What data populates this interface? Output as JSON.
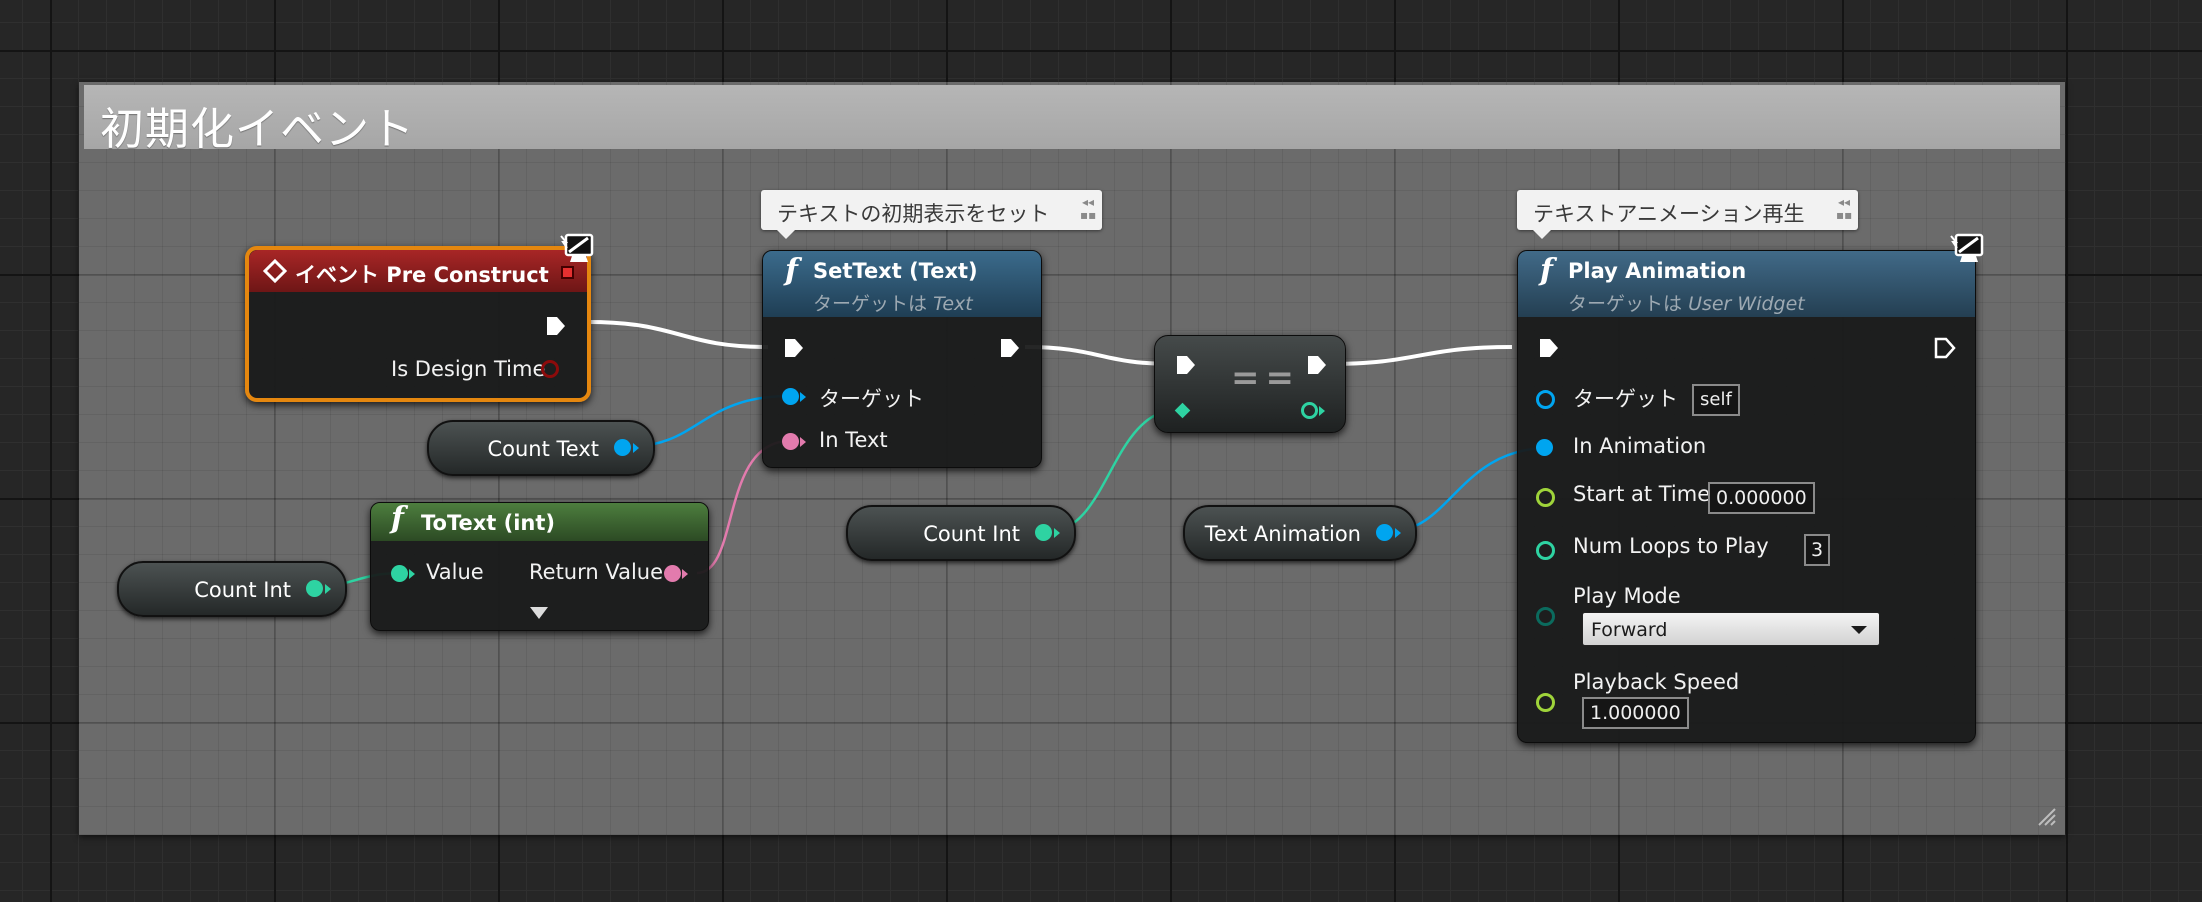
{
  "comment": {
    "title": "初期化イベント"
  },
  "colors": {
    "event_header": "#8f1d1d",
    "event_border": "#e5870f",
    "settext_header": "#2f5875",
    "playanim_header": "#3b5c75",
    "totext_header": "#3f6b33",
    "object_pin": "#00a5f0",
    "text_pin": "#e27bad",
    "int_pin": "#2ed3a2",
    "float_pin": "#9fd43a",
    "byte_pin": "#0b6b5e",
    "bool_pin": "#8c0b0b",
    "exec_pin": "#ffffff"
  },
  "bubbles": {
    "settext": "テキストの初期表示をセット",
    "playanim": "テキストアニメーション再生"
  },
  "event_node": {
    "icon": "event-diamond-icon",
    "title": "イベント Pre Construct",
    "pins": {
      "is_design_time": "Is Design Time"
    }
  },
  "settext_node": {
    "icon": "function-f-icon",
    "title": "SetText (Text)",
    "subtitle_prefix": "ターゲットは",
    "subtitle_target": "Text",
    "pins": {
      "target": "ターゲット",
      "in_text": "In Text"
    }
  },
  "equals_node": {
    "label": "=="
  },
  "playanim_node": {
    "icon": "function-f-icon",
    "title": "Play Animation",
    "subtitle_prefix": "ターゲットは",
    "subtitle_target": "User Widget",
    "pins": {
      "target": "ターゲット",
      "target_value": "self",
      "in_animation": "In Animation",
      "start_at_time": "Start at Time",
      "start_at_time_value": "0.000000",
      "num_loops": "Num Loops to Play",
      "num_loops_value": "3",
      "play_mode": "Play Mode",
      "play_mode_value": "Forward",
      "playback_speed": "Playback Speed",
      "playback_speed_value": "1.000000"
    }
  },
  "totext_node": {
    "icon": "function-f-icon",
    "title": "ToText (int)",
    "pins": {
      "value": "Value",
      "return_value": "Return Value"
    },
    "expand_icon": "expand-arrow-icon"
  },
  "variables": {
    "count_text": "Count Text",
    "count_int_left": "Count Int",
    "count_int_mid": "Count Int",
    "text_animation": "Text Animation"
  }
}
